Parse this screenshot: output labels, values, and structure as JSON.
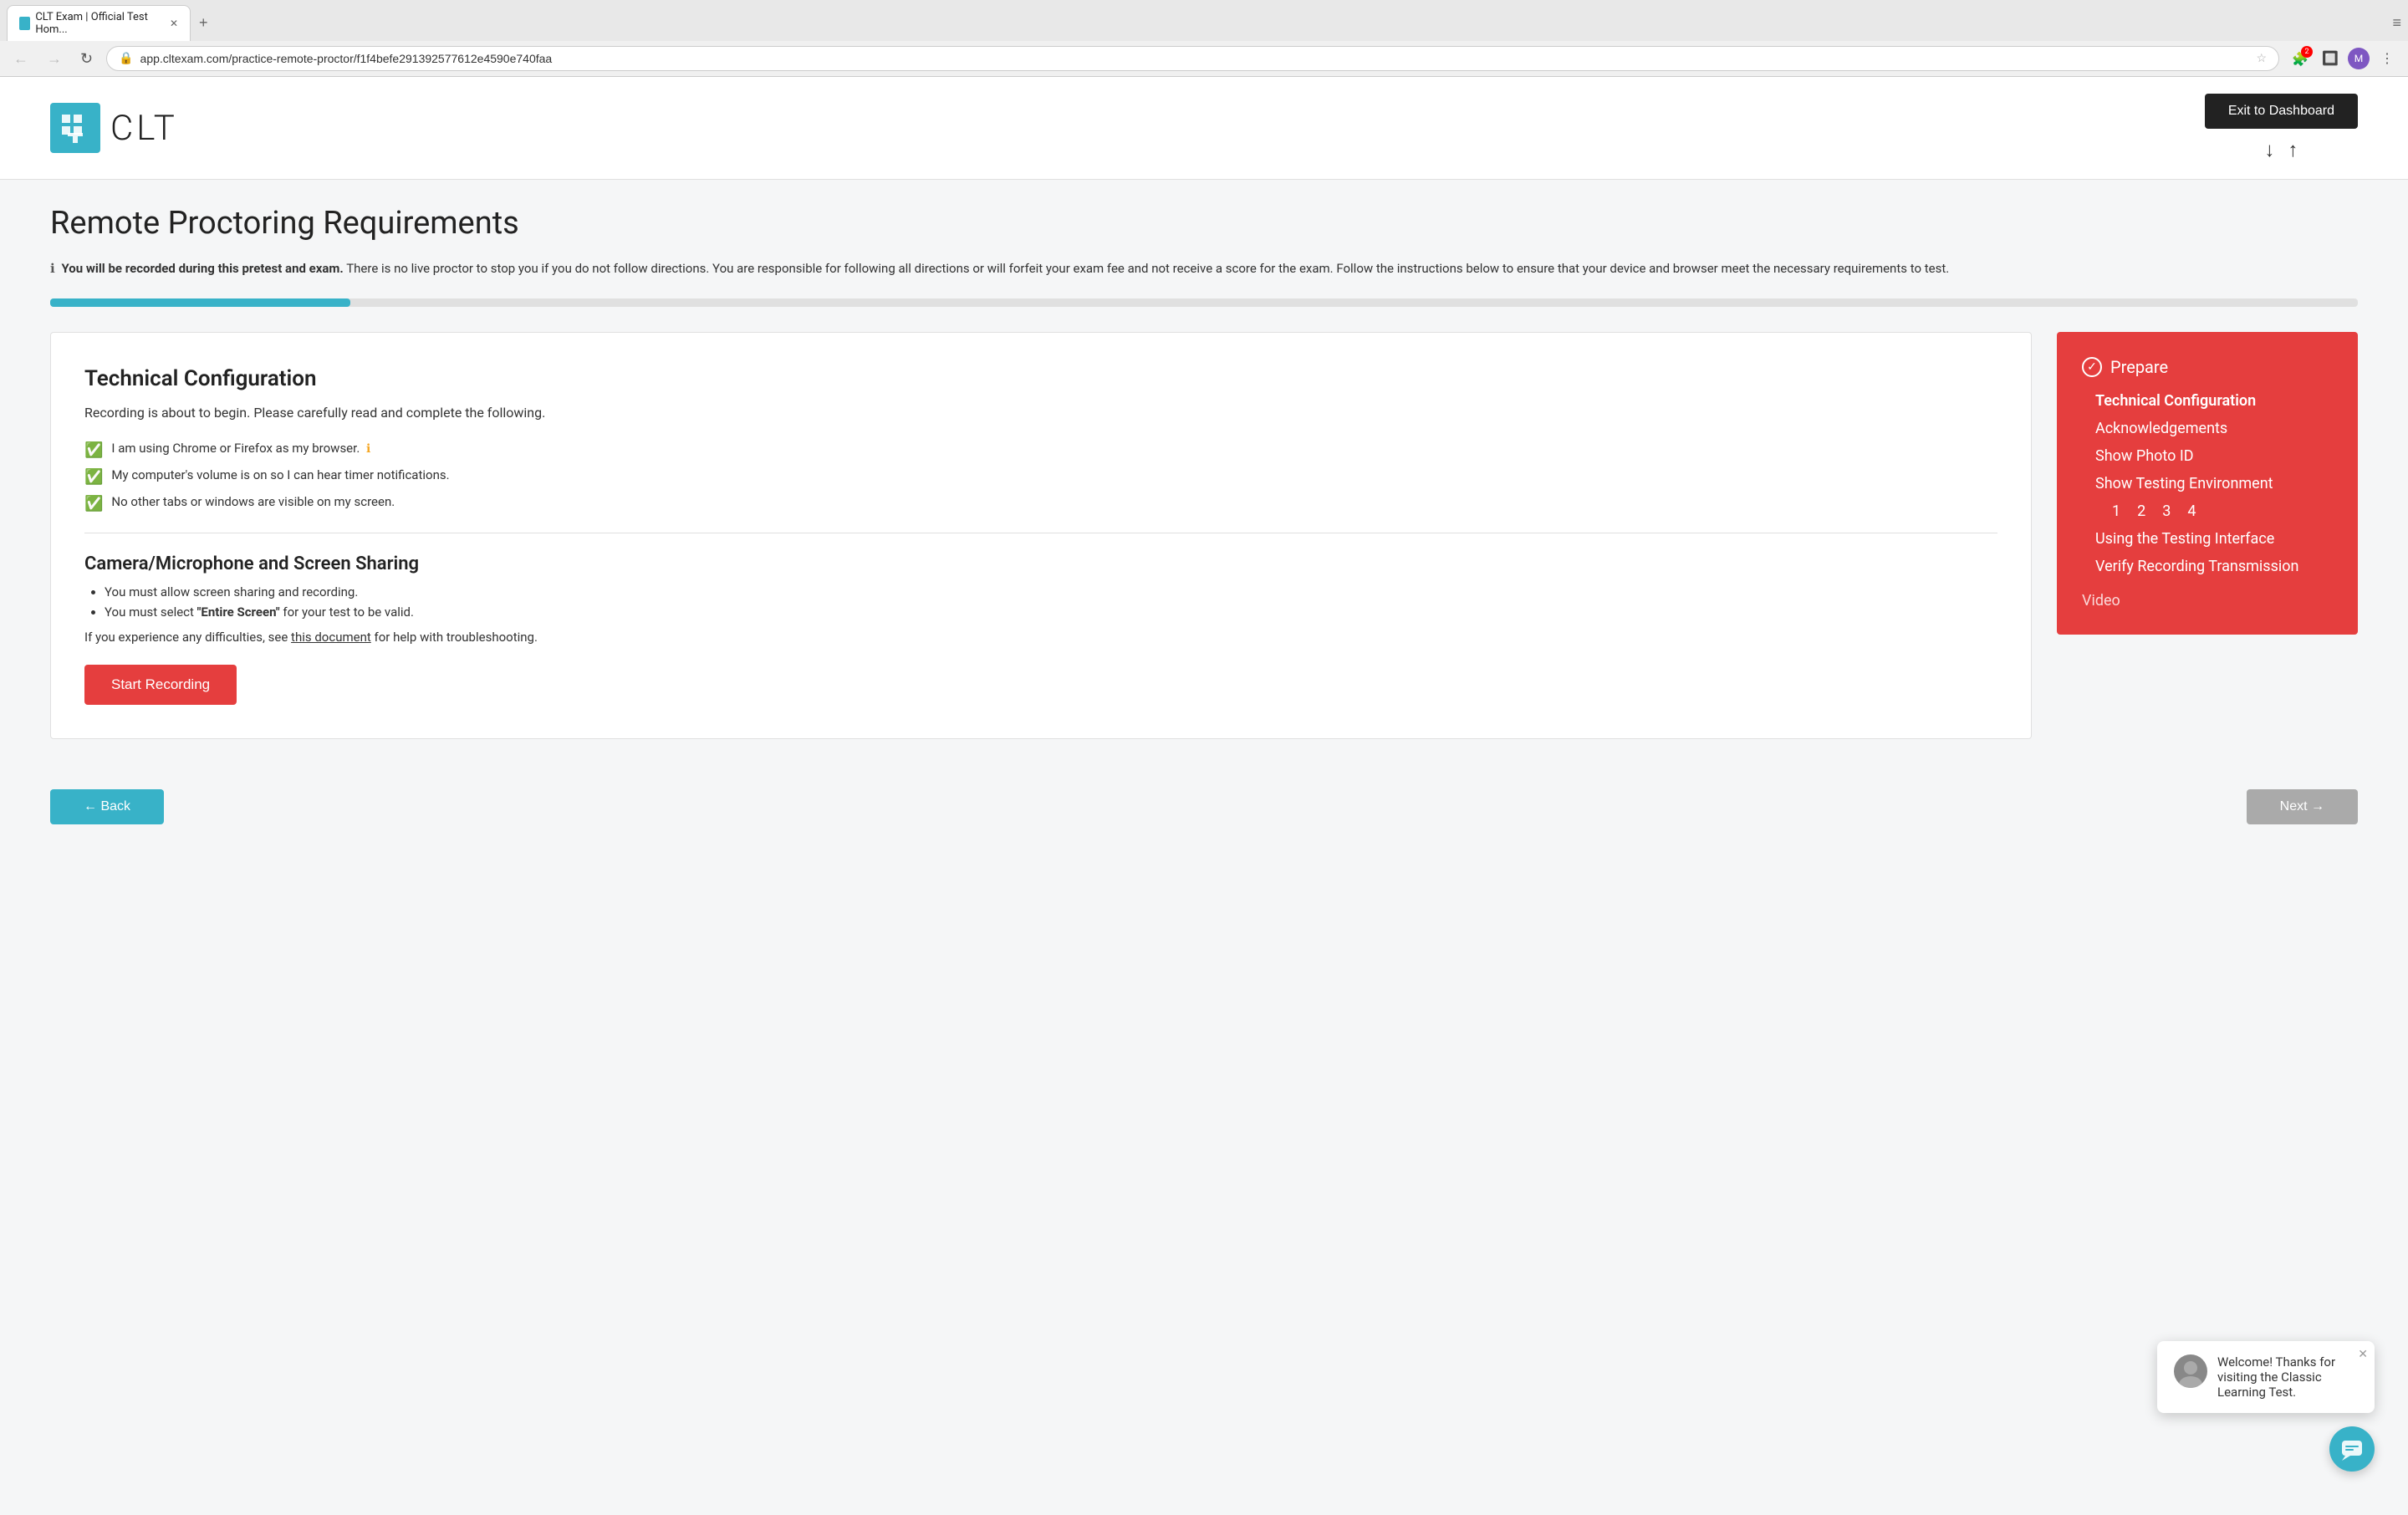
{
  "browser": {
    "tab_title": "CLT Exam | Official Test Hom...",
    "url": "app.cltexam.com/practice-remote-proctor/f1f4befe291392577612e4590e740faa",
    "new_tab_label": "+",
    "back_title": "Back",
    "forward_title": "Forward",
    "refresh_title": "Refresh",
    "badge_count": "2",
    "avatar_label": "M",
    "more_label": "⋮"
  },
  "header": {
    "logo_text": "CLT",
    "exit_button_label": "Exit to Dashboard",
    "down_arrow": "↓",
    "up_arrow": "↑"
  },
  "page": {
    "title": "Remote Proctoring Requirements",
    "warning_bold": "You will be recorded during this pretest and exam.",
    "warning_text": " There is no live proctor to stop you if you do not follow directions. You are responsible for following all directions or will forfeit your exam fee and not receive a score for the exam. Follow the instructions below to ensure that your device and browser meet the necessary requirements to test.",
    "progress_percent": 13
  },
  "main_section": {
    "title": "Technical Configuration",
    "subtitle": "Recording is about to begin. Please carefully read and complete the following.",
    "checklist": [
      {
        "text": "I am using Chrome or Firefox as my browser.",
        "has_info": true
      },
      {
        "text": "My computer's volume is on so I can hear timer notifications.",
        "has_info": false
      },
      {
        "text": "No other tabs or windows are visible on my screen.",
        "has_info": false
      }
    ],
    "camera_section_title": "Camera/Microphone and Screen Sharing",
    "bullets": [
      "You must allow screen sharing and recording.",
      "You must select \"Entire Screen\" for your test to be valid."
    ],
    "trouble_text_prefix": "If you experience any difficulties, see ",
    "trouble_link_text": "this document",
    "trouble_text_suffix": " for help with troubleshooting.",
    "start_button_label": "Start Recording"
  },
  "sidebar": {
    "prepare_label": "Prepare",
    "check_symbol": "✓",
    "items": [
      {
        "label": "Technical Configuration",
        "active": true
      },
      {
        "label": "Acknowledgements",
        "active": false
      },
      {
        "label": "Show Photo ID",
        "active": false
      },
      {
        "label": "Show Testing Environment",
        "active": false
      },
      {
        "sub_items": [
          "1",
          "2",
          "3",
          "4"
        ]
      },
      {
        "label": "Using the Testing Interface",
        "active": false
      },
      {
        "label": "Verify Recording Transmission",
        "active": false
      }
    ],
    "video_label": "Video"
  },
  "chat": {
    "welcome_message": "Welcome! Thanks for visiting the Classic Learning Test.",
    "close_symbol": "✕",
    "chat_icon": "💬"
  },
  "bottom_nav": {
    "back_label": "← Back",
    "next_label": "Next →"
  }
}
